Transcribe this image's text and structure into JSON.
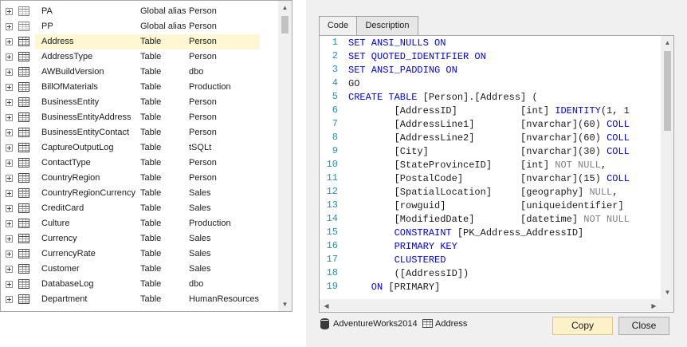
{
  "object_list": {
    "rows": [
      {
        "name": "PA",
        "type": "Global alias",
        "schema": "Person",
        "icon": "alias-icon"
      },
      {
        "name": "PP",
        "type": "Global alias",
        "schema": "Person",
        "icon": "alias-icon"
      },
      {
        "name": "Address",
        "type": "Table",
        "schema": "Person",
        "icon": "table-icon",
        "selected": true
      },
      {
        "name": "AddressType",
        "type": "Table",
        "schema": "Person",
        "icon": "table-icon"
      },
      {
        "name": "AWBuildVersion",
        "type": "Table",
        "schema": "dbo",
        "icon": "table-icon"
      },
      {
        "name": "BillOfMaterials",
        "type": "Table",
        "schema": "Production",
        "icon": "table-icon"
      },
      {
        "name": "BusinessEntity",
        "type": "Table",
        "schema": "Person",
        "icon": "table-icon"
      },
      {
        "name": "BusinessEntityAddress",
        "type": "Table",
        "schema": "Person",
        "icon": "table-icon"
      },
      {
        "name": "BusinessEntityContact",
        "type": "Table",
        "schema": "Person",
        "icon": "table-icon"
      },
      {
        "name": "CaptureOutputLog",
        "type": "Table",
        "schema": "tSQLt",
        "icon": "table-icon"
      },
      {
        "name": "ContactType",
        "type": "Table",
        "schema": "Person",
        "icon": "table-icon"
      },
      {
        "name": "CountryRegion",
        "type": "Table",
        "schema": "Person",
        "icon": "table-icon"
      },
      {
        "name": "CountryRegionCurrency",
        "type": "Table",
        "schema": "Sales",
        "icon": "table-icon"
      },
      {
        "name": "CreditCard",
        "type": "Table",
        "schema": "Sales",
        "icon": "table-icon"
      },
      {
        "name": "Culture",
        "type": "Table",
        "schema": "Production",
        "icon": "table-icon"
      },
      {
        "name": "Currency",
        "type": "Table",
        "schema": "Sales",
        "icon": "table-icon"
      },
      {
        "name": "CurrencyRate",
        "type": "Table",
        "schema": "Sales",
        "icon": "table-icon"
      },
      {
        "name": "Customer",
        "type": "Table",
        "schema": "Sales",
        "icon": "table-icon"
      },
      {
        "name": "DatabaseLog",
        "type": "Table",
        "schema": "dbo",
        "icon": "table-icon"
      },
      {
        "name": "Department",
        "type": "Table",
        "schema": "HumanResources",
        "icon": "table-icon"
      }
    ]
  },
  "tabs": [
    {
      "label": "Code",
      "active": true
    },
    {
      "label": "Description",
      "active": false
    }
  ],
  "code": {
    "line_numbers": [
      "1",
      "2",
      "3",
      "4",
      "5",
      "6",
      "7",
      "8",
      "9",
      "10",
      "11",
      "12",
      "13",
      "14",
      "15",
      "16",
      "17",
      "18",
      "19"
    ],
    "lines": [
      [
        {
          "t": "SET ANSI_NULLS ON",
          "c": "kw"
        }
      ],
      [
        {
          "t": "SET QUOTED_IDENTIFIER ON",
          "c": "kw"
        }
      ],
      [
        {
          "t": "SET ANSI_PADDING ON",
          "c": "kw"
        }
      ],
      [
        {
          "t": "GO",
          "c": "id"
        }
      ],
      [
        {
          "t": "CREATE TABLE ",
          "c": "kw"
        },
        {
          "t": "[Person].[Address] (",
          "c": "id"
        }
      ],
      [
        {
          "t": "        [AddressID]           [int] ",
          "c": "id"
        },
        {
          "t": "IDENTITY",
          "c": "kw"
        },
        {
          "t": "(1, 1",
          "c": "id"
        }
      ],
      [
        {
          "t": "        [AddressLine1]        [nvarchar](60) ",
          "c": "id"
        },
        {
          "t": "COLL",
          "c": "kw"
        }
      ],
      [
        {
          "t": "        [AddressLine2]        [nvarchar](60) ",
          "c": "id"
        },
        {
          "t": "COLL",
          "c": "kw"
        }
      ],
      [
        {
          "t": "        [City]                [nvarchar](30) ",
          "c": "id"
        },
        {
          "t": "COLL",
          "c": "kw"
        }
      ],
      [
        {
          "t": "        [StateProvinceID]     [int] ",
          "c": "id"
        },
        {
          "t": "NOT NULL",
          "c": "gr"
        },
        {
          "t": ",",
          "c": "id"
        }
      ],
      [
        {
          "t": "        [PostalCode]          [nvarchar](15) ",
          "c": "id"
        },
        {
          "t": "COLL",
          "c": "kw"
        }
      ],
      [
        {
          "t": "        [SpatialLocation]     [geography] ",
          "c": "id"
        },
        {
          "t": "NULL",
          "c": "gr"
        },
        {
          "t": ",",
          "c": "id"
        }
      ],
      [
        {
          "t": "        [rowguid]             [uniqueidentifier]",
          "c": "id"
        }
      ],
      [
        {
          "t": "        [ModifiedDate]        [datetime] ",
          "c": "id"
        },
        {
          "t": "NOT NULL",
          "c": "gr"
        }
      ],
      [
        {
          "t": "        CONSTRAINT ",
          "c": "kw"
        },
        {
          "t": "[PK_Address_AddressID]",
          "c": "id"
        }
      ],
      [
        {
          "t": "        PRIMARY KEY",
          "c": "kw"
        }
      ],
      [
        {
          "t": "        CLUSTERED",
          "c": "kw"
        }
      ],
      [
        {
          "t": "        ([AddressID])",
          "c": "id"
        }
      ],
      [
        {
          "t": "    ON ",
          "c": "kw"
        },
        {
          "t": "[PRIMARY]",
          "c": "id"
        }
      ]
    ]
  },
  "status": {
    "database": "AdventureWorks2014",
    "object": "Address"
  },
  "buttons": {
    "copy": "Copy",
    "close": "Close"
  },
  "colors": {
    "keyword": "#0000ff",
    "line_number": "#2b91af",
    "selection": "#fff6d2",
    "copy_button": "#fcf1c9"
  }
}
